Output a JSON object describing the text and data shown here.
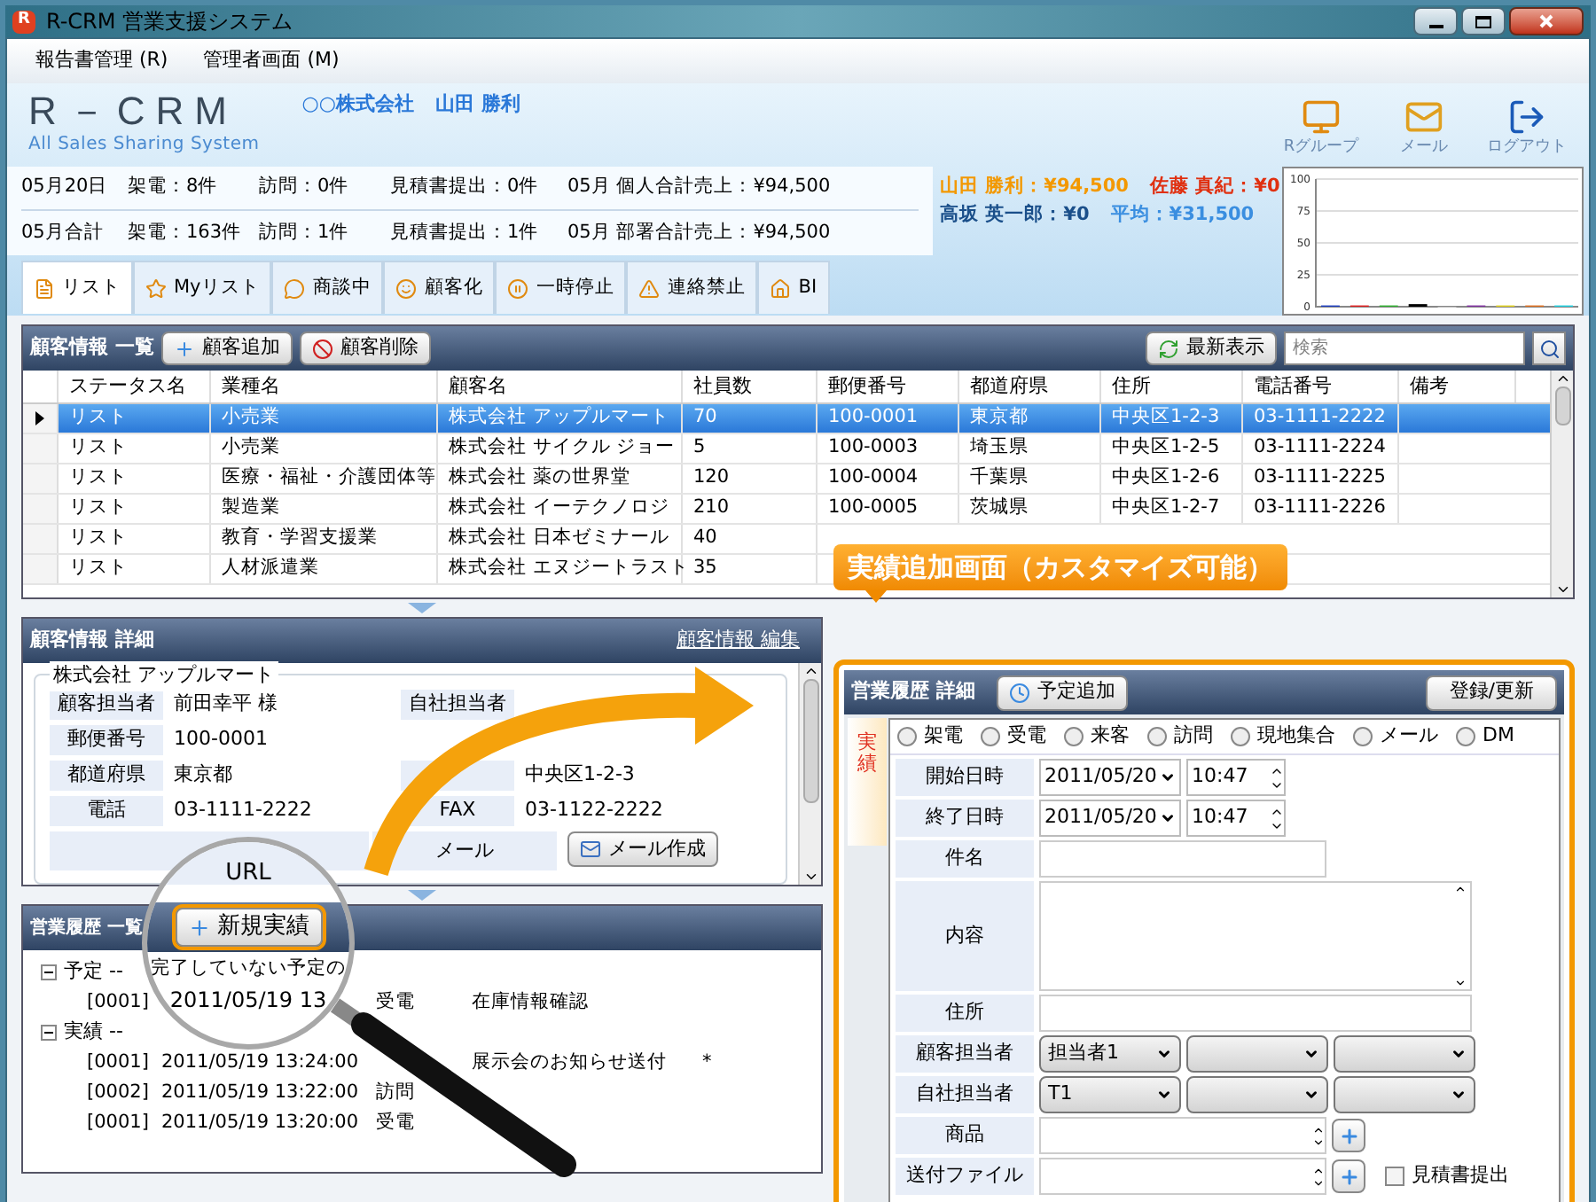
{
  "window": {
    "title": "R-CRM 営業支援システム",
    "icon_letter": "R"
  },
  "menu": [
    "報告書管理 (R)",
    "管理者画面 (M)"
  ],
  "header": {
    "logo": "R－CRM",
    "tagline": "All Sales Sharing System",
    "company": "○○株式会社",
    "user": "山田 勝利",
    "actions": [
      {
        "label": "Rグループ",
        "kind": "group"
      },
      {
        "label": "メール",
        "kind": "mail"
      },
      {
        "label": "ログアウト",
        "kind": "logout"
      }
    ]
  },
  "stats": [
    [
      "05月20日",
      "架電：8件",
      "訪問：0件",
      "見積書提出：0件",
      "05月 個人合計売上：¥94,500"
    ],
    [
      "05月合計",
      "架電：163件",
      "訪問：1件",
      "見積書提出：1件",
      "05月 部署合計売上：¥94,500"
    ]
  ],
  "ranking": [
    [
      {
        "text": "山田 勝利：¥94,500",
        "color": "#f39800"
      },
      {
        "text": "佐藤 真紀：¥0",
        "color": "#e03010"
      }
    ],
    [
      {
        "text": "高坂 英一郎：¥0",
        "color": "#1a4f8a"
      },
      {
        "text": "平均：¥31,500",
        "color": "#3a8ee0"
      }
    ]
  ],
  "chart": {
    "chart_data": {
      "type": "bar",
      "grid": true,
      "ylim": [
        0,
        100
      ],
      "yticks": [
        0,
        25,
        50,
        75,
        100
      ],
      "values": [
        1,
        1,
        1,
        2,
        0,
        1,
        1,
        1,
        1
      ],
      "colors": [
        "#1f3fbf",
        "#e02020",
        "#30b030",
        "#000000",
        "#c0c0c0",
        "#8030a0",
        "#e0d020",
        "#e07020",
        "#20d0e0"
      ]
    }
  },
  "tabs": [
    {
      "label": "リスト",
      "selected": true
    },
    {
      "label": "Myリスト",
      "selected": false
    },
    {
      "label": "商談中",
      "selected": false
    },
    {
      "label": "顧客化",
      "selected": false
    },
    {
      "label": "一時停止",
      "selected": false
    },
    {
      "label": "連絡禁止",
      "selected": false
    },
    {
      "label": "BI",
      "selected": false
    }
  ],
  "customer_list": {
    "title": "顧客情報 一覧",
    "buttons": [
      {
        "label": "顧客追加",
        "kind": "add"
      },
      {
        "label": "顧客削除",
        "kind": "delete"
      }
    ],
    "refresh_button": "最新表示",
    "search": {
      "placeholder": "検索"
    },
    "columns": [
      "ステータス名",
      "業種名",
      "顧客名",
      "社員数",
      "郵便番号",
      "都道府県",
      "住所",
      "電話番号",
      "備考"
    ],
    "rows": [
      {
        "selected": true,
        "cells": [
          "リスト",
          "小売業",
          "株式会社 アップルマート",
          "70",
          "100-0001",
          "東京都",
          "中央区1-2-3",
          "03-1111-2222"
        ]
      },
      {
        "selected": false,
        "cells": [
          "リスト",
          "小売業",
          "株式会社 サイクル ジョー",
          "5",
          "100-0003",
          "埼玉県",
          "中央区1-2-5",
          "03-1111-2224"
        ]
      },
      {
        "selected": false,
        "cells": [
          "リスト",
          "医療・福祉・介護団体等",
          "株式会社 薬の世界堂",
          "120",
          "100-0004",
          "千葉県",
          "中央区1-2-6",
          "03-1111-2225"
        ]
      },
      {
        "selected": false,
        "cells": [
          "リスト",
          "製造業",
          "株式会社 イーテクノロジ",
          "210",
          "100-0005",
          "茨城県",
          "中央区1-2-7",
          "03-1111-2226"
        ]
      },
      {
        "selected": false,
        "cells": [
          "リスト",
          "教育・学習支援業",
          "株式会社 日本ゼミナール",
          "40"
        ]
      },
      {
        "selected": false,
        "cells": [
          "リスト",
          "人材派遣業",
          "株式会社 エヌジートラスト",
          "35"
        ]
      }
    ]
  },
  "callout": "実績追加画面（カスタマイズ可能）",
  "customer_detail": {
    "title": "顧客情報 詳細",
    "edit_link": "顧客情報 編集",
    "group_title": "株式会社 アップルマート",
    "rows": [
      [
        {
          "label": "顧客担当者",
          "value": "前田幸平 様"
        },
        {
          "label": "自社担当者"
        }
      ],
      [
        {
          "label": "郵便番号",
          "value": "100-0001"
        }
      ],
      [
        {
          "label": "都道府県",
          "value": "東京都"
        },
        {
          "value": "中央区1-2-3"
        }
      ],
      [
        {
          "label": "電話",
          "value": "03-1111-2222"
        },
        {
          "label": "FAX",
          "value": "03-1122-2222"
        }
      ]
    ],
    "mail_label": "メール",
    "mail_button": "メール作成"
  },
  "magnifier": {
    "texts": [
      "URL",
      "完了していない予定の",
      "2011/05/19 13"
    ]
  },
  "sales_history": {
    "title": "営業履歴 一覧",
    "new_button": "新規実績",
    "groups": [
      {
        "label": "予定 --",
        "expanded": true,
        "children": [
          {
            "code": "[0001]",
            "type": "受電",
            "subject": "在庫情報確認"
          }
        ]
      },
      {
        "label": "実績 --",
        "expanded": true,
        "children": [
          {
            "code": "[0001]",
            "datetime": "2011/05/19 13:24:00",
            "subject": "展示会のお知らせ送付",
            "mark": "*"
          },
          {
            "code": "[0002]",
            "datetime": "2011/05/19 13:22:00",
            "type": "訪問"
          },
          {
            "code": "[0001]",
            "datetime": "2011/05/19 13:20:00",
            "type": "受電"
          }
        ]
      }
    ]
  },
  "sales_detail": {
    "title": "営業履歴 詳細",
    "schedule_button": "予定追加",
    "save_button": "登録/更新",
    "side_tab": "実績",
    "contact_types": [
      {
        "label": "架電",
        "selected": false
      },
      {
        "label": "受電",
        "selected": false
      },
      {
        "label": "来客",
        "selected": false
      },
      {
        "label": "訪問",
        "selected": false
      },
      {
        "label": "現地集合",
        "selected": false
      },
      {
        "label": "メール",
        "selected": false
      },
      {
        "label": "DM",
        "selected": false
      }
    ],
    "rows": [
      {
        "label": "開始日時",
        "kind": "datetime",
        "date": "2011/05/20",
        "time": "10:47"
      },
      {
        "label": "終了日時",
        "kind": "datetime",
        "date": "2011/05/20",
        "time": "10:47"
      },
      {
        "label": "件名",
        "kind": "text"
      },
      {
        "label": "内容",
        "kind": "textarea"
      },
      {
        "label": "住所",
        "kind": "wide_text"
      },
      {
        "label": "顧客担当者",
        "kind": "selects",
        "value": "担当者1"
      },
      {
        "label": "自社担当者",
        "kind": "selects",
        "value": "T1"
      },
      {
        "label": "商品",
        "kind": "picker"
      },
      {
        "label": "送付ファイル",
        "kind": "picker",
        "checkbox": {
          "label": "見積書提出",
          "checked": false
        }
      }
    ]
  }
}
